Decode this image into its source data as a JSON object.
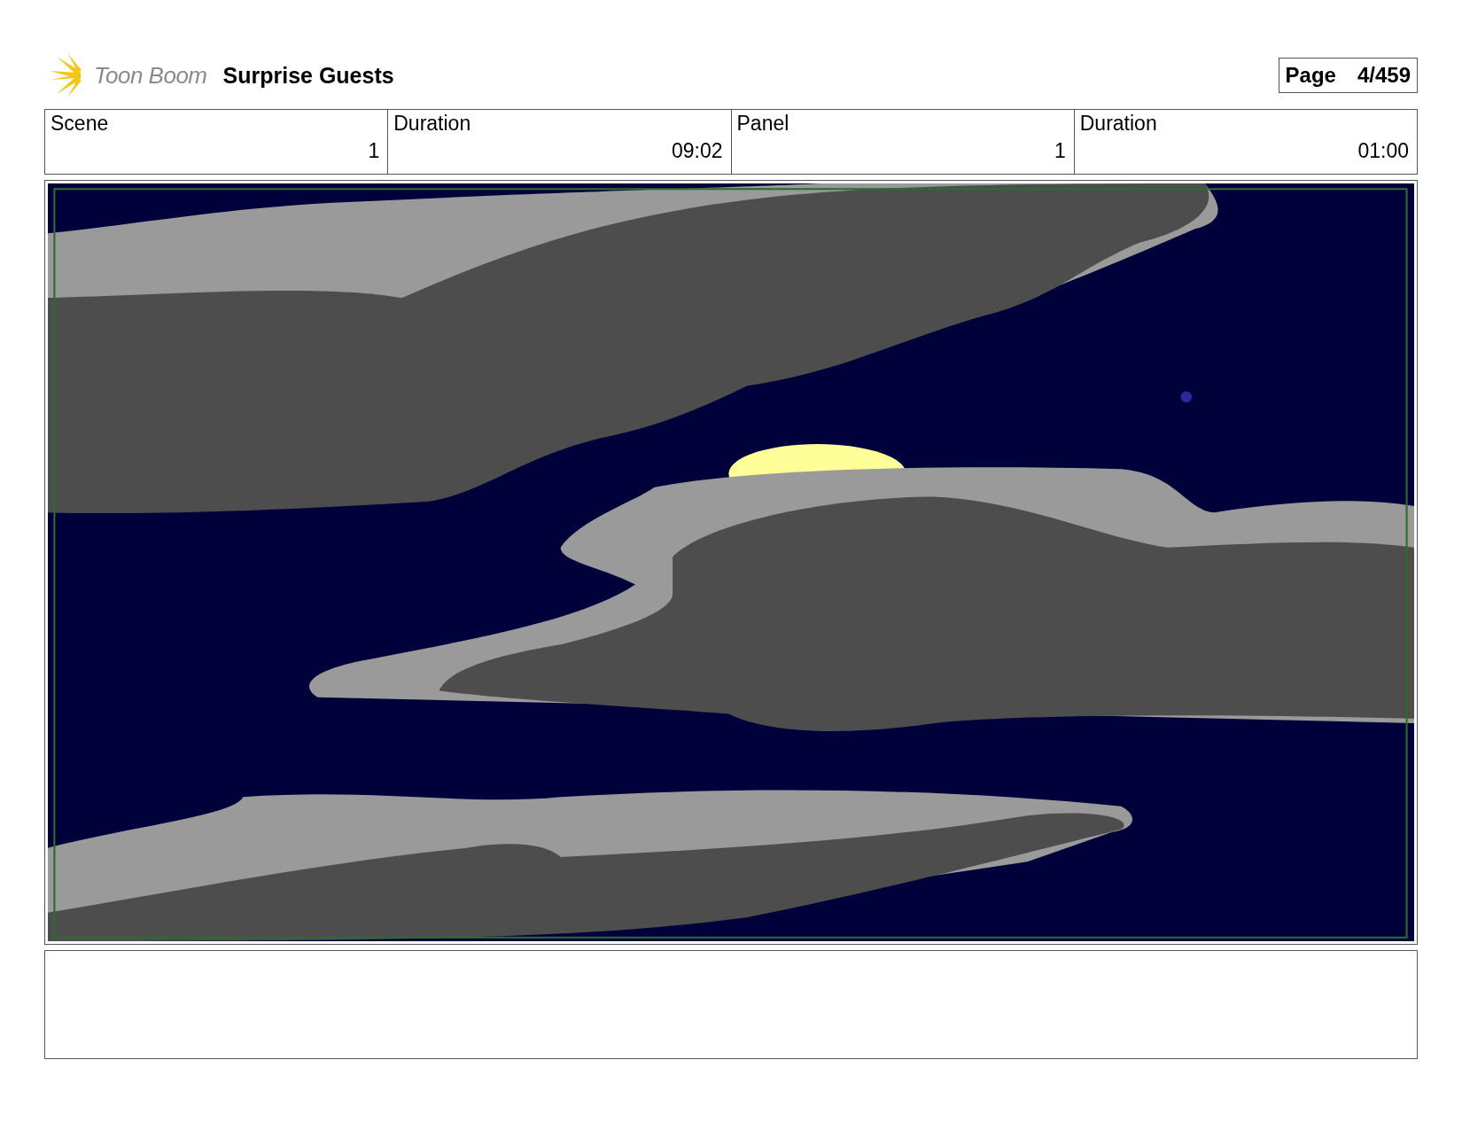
{
  "header": {
    "logo_text": "Toon Boom",
    "title": "Surprise Guests",
    "page_label": "Page",
    "page_number": "4/459"
  },
  "info_table": {
    "columns": [
      "Scene",
      "Duration",
      "Panel",
      "Duration"
    ],
    "cells": [
      "1",
      "09:02",
      "1",
      "01:00"
    ]
  }
}
